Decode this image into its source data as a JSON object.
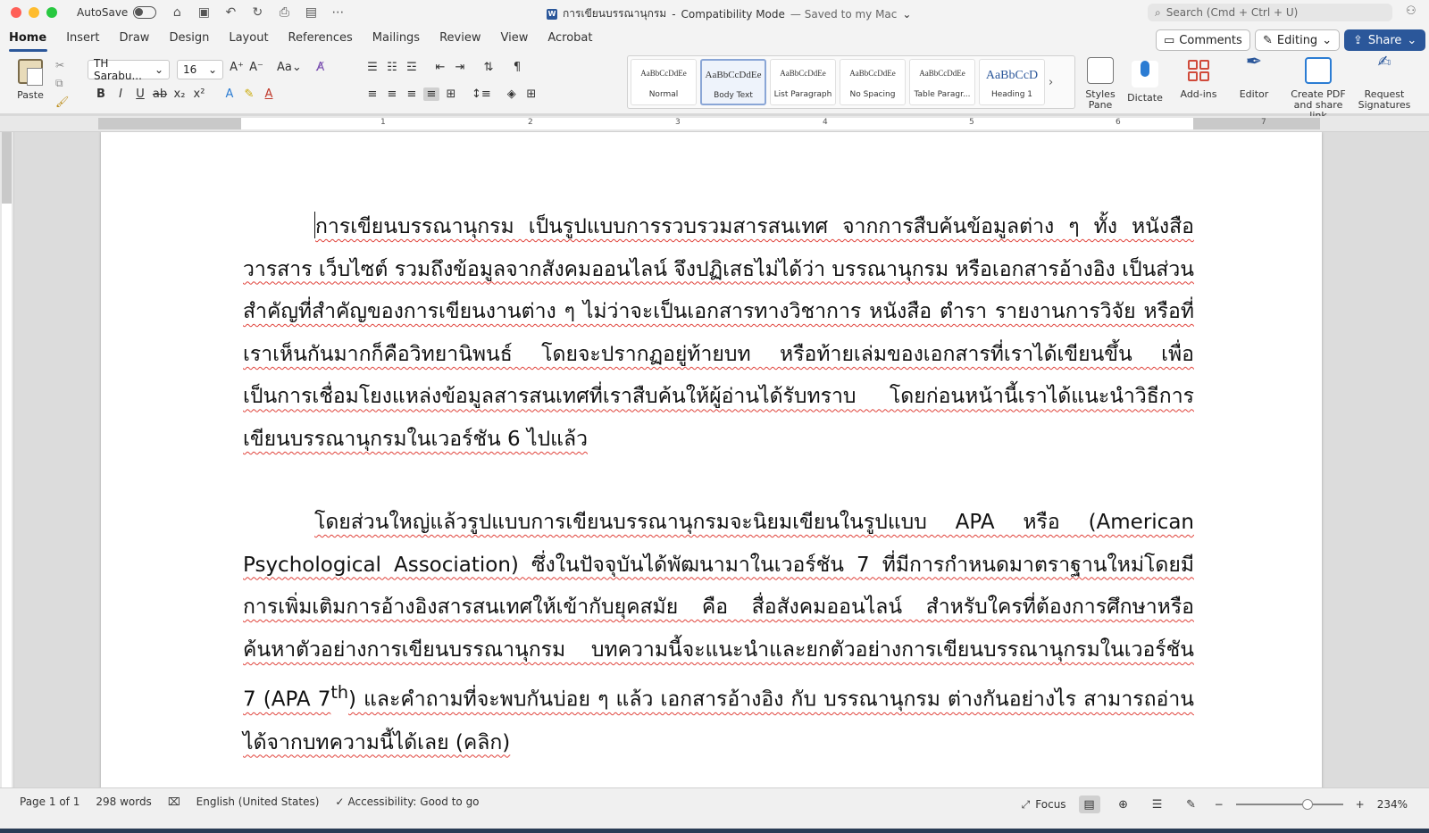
{
  "window": {
    "autosave_label": "AutoSave",
    "doc_title": "การเขียนบรรณานุกรม",
    "mode": "Compatibility Mode",
    "save_status": "— Saved to my Mac",
    "search_placeholder": "Search (Cmd + Ctrl + U)"
  },
  "tabs": [
    "Home",
    "Insert",
    "Draw",
    "Design",
    "Layout",
    "References",
    "Mailings",
    "Review",
    "View",
    "Acrobat"
  ],
  "ribbon_right": {
    "comments": "Comments",
    "editing": "Editing",
    "share": "Share"
  },
  "ribbon": {
    "paste": "Paste",
    "font_name": "TH Sarabu...",
    "font_size": "16",
    "styles": [
      {
        "sample": "AaBbCcDdEe",
        "name": "Normal"
      },
      {
        "sample": "AaBbCcDdEe",
        "name": "Body Text"
      },
      {
        "sample": "AaBbCcDdEe",
        "name": "List Paragraph"
      },
      {
        "sample": "AaBbCcDdEe",
        "name": "No Spacing"
      },
      {
        "sample": "AaBbCcDdEe",
        "name": "Table Paragr..."
      },
      {
        "sample": "AaBbCcD",
        "name": "Heading 1"
      }
    ],
    "styles_pane": "Styles Pane",
    "dictate": "Dictate",
    "addins": "Add-ins",
    "editor": "Editor",
    "create_pdf": "Create PDF and share link",
    "request_sign": "Request Signatures"
  },
  "ruler": {
    "numbers": [
      "1",
      "2",
      "3",
      "4",
      "5",
      "6",
      "7"
    ]
  },
  "document": {
    "para1": "การเขียนบรรณานุกรม เป็นรูปแบบการรวบรวมสารสนเทศ จากการสืบค้นข้อมูลต่าง ๆ ทั้ง หนังสือ วารสาร เว็บไซต์ รวมถึงข้อมูลจากสังคมออนไลน์ จึงปฏิเสธไม่ได้ว่า บรรณานุกรม หรือเอกสารอ้างอิง เป็นส่วนสำคัญที่สำคัญของการเขียนงานต่าง ๆ ไม่ว่าจะเป็นเอกสารทางวิชาการ หนังสือ ตำรา รายงานการวิจัย หรือที่เราเห็นกันมากก็คือวิทยานิพนธ์ โดยจะปรากฏอยู่ท้ายบท หรือท้ายเล่มของเอกสารที่เราได้เขียนขึ้น เพื่อเป็นการเชื่อมโยงแหล่งข้อมูลสารสนเทศที่เราสืบค้นให้ผู้อ่านได้รับทราบ โดยก่อนหน้านี้เราได้แนะนำวิธีการเขียนบรรณานุกรมในเวอร์ชัน 6 ไปแล้ว",
    "para2a": "โดยส่วนใหญ่แล้วรูปแบบการเขียนบรรณานุกรมจะนิยมเขียนในรูปแบบ APA หรือ (American Psychological Association) ซึ่งในปัจจุบันได้พัฒนามาในเวอร์ชัน 7 ที่มีการกำหนดมาตราฐานใหม่โดยมีการเพิ่มเติมการอ้างอิงสารสนเทศให้เข้ากับยุคสมัย คือ สื่อสังคมออนไลน์ สำหรับใครที่ต้องการศึกษาหรือค้นหาตัวอย่างการเขียนบรรณานุกรม บทความนี้จะแนะนำและยกตัวอย่างการเขียนบรรณานุกรมในเวอร์ชัน 7 (APA 7",
    "para2_sup": "th",
    "para2b": ") และคำถามที่จะพบกันบ่อย ๆ แล้ว เอกสารอ้างอิง กับ บรรณานุกรม ต่างกันอย่างไร สามารถอ่านได้จากบทความนี้ได้เลย (คลิก)"
  },
  "status": {
    "page": "Page 1 of 1",
    "words": "298 words",
    "language": "English (United States)",
    "accessibility": "Accessibility: Good to go",
    "focus": "Focus",
    "zoom": "234%"
  },
  "colors": {
    "accent": "#2b579a",
    "spell_underline": "#e0433b"
  }
}
